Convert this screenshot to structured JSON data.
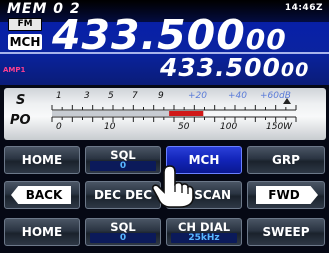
{
  "display": {
    "memory_label": "MEM 0 2",
    "clock": "14:46Z",
    "mode_badge": "FM",
    "channel_mode_badge": "MCH",
    "main_frequency": "433.500",
    "main_frequency_small": "00",
    "amp_label": "AMP1",
    "sub_frequency": "433.500",
    "sub_frequency_small": "00"
  },
  "meter": {
    "s_label": "S",
    "po_label": "PO",
    "s_scale": [
      "1",
      "3",
      "5",
      "7",
      "9",
      "+20",
      "+40",
      "+60dB"
    ],
    "po_scale": [
      "0",
      "10",
      "50",
      "100",
      "150W"
    ],
    "level": 0.62
  },
  "buttons": {
    "row1": [
      {
        "label": "HOME",
        "sub": ""
      },
      {
        "label": "SQL",
        "sub": "0"
      },
      {
        "label": "MCH",
        "sub": ""
      },
      {
        "label": "GRP",
        "sub": ""
      }
    ],
    "row2": [
      {
        "label": "BACK"
      },
      {
        "label": "DEC DEC"
      },
      {
        "label": "SCAN"
      },
      {
        "label": "FWD"
      }
    ],
    "row3": [
      {
        "label": "HOME",
        "sub": ""
      },
      {
        "label": "SQL",
        "sub": "0"
      },
      {
        "label": "CH DIAL",
        "sub": "25kHz"
      },
      {
        "label": "SWEEP",
        "sub": ""
      }
    ]
  },
  "colors": {
    "display_blue": "#0a23a0",
    "active_button": "#1224b8",
    "sub_value": "#58b7ff",
    "meter_red": "#d01818",
    "amp_pink": "#ff3f8f"
  },
  "icons": {
    "hand": "pointing-hand-icon"
  }
}
